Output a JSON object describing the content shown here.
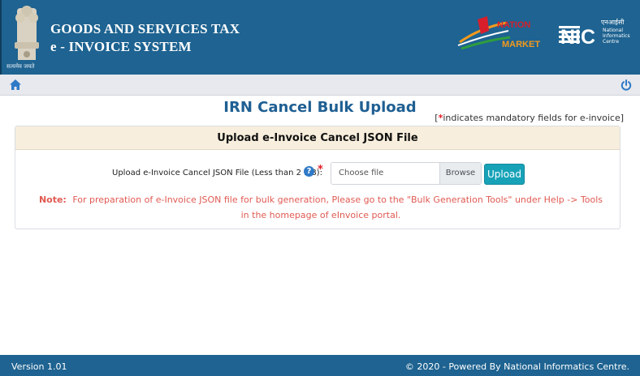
{
  "header": {
    "title_line1": "GOODS AND SERVICES TAX",
    "title_line2": "e - INVOICE SYSTEM",
    "emblem_caption": "सत्यमेव जयते",
    "nm_logo_lines": [
      "NATION",
      "MARKET"
    ],
    "nic_logo": {
      "mark": "NIC",
      "hindi": "एनआईसी",
      "lines": [
        "National",
        "Informatics",
        "Centre"
      ]
    },
    "colors": {
      "bar": "#1e6391",
      "title": "#ffffff"
    }
  },
  "nav": {
    "home_icon": "home-icon",
    "power_icon": "power-icon"
  },
  "main": {
    "page_title": "IRN Cancel Bulk Upload",
    "mandatory_open": "[",
    "mandatory_star": "*",
    "mandatory_text": "indicates mandatory fields for e-invoice]",
    "panel_title": "Upload e-Invoice Cancel JSON File",
    "field_label": "Upload e-Invoice Cancel JSON File (Less than 2 MB):",
    "help_glyph": "?",
    "required_star": "*",
    "file_placeholder": "Choose file",
    "browse_label": "Browse",
    "upload_label": "Upload",
    "note_label": "Note:",
    "note_text": "For preparation of e-Invoice JSON file for bulk generation, Please go to the \"Bulk Generation Tools\" under Help -> Tools in the homepage of eInvoice portal."
  },
  "footer": {
    "version": "Version 1.01",
    "copyright": "© 2020 - Powered By National Informatics Centre."
  }
}
